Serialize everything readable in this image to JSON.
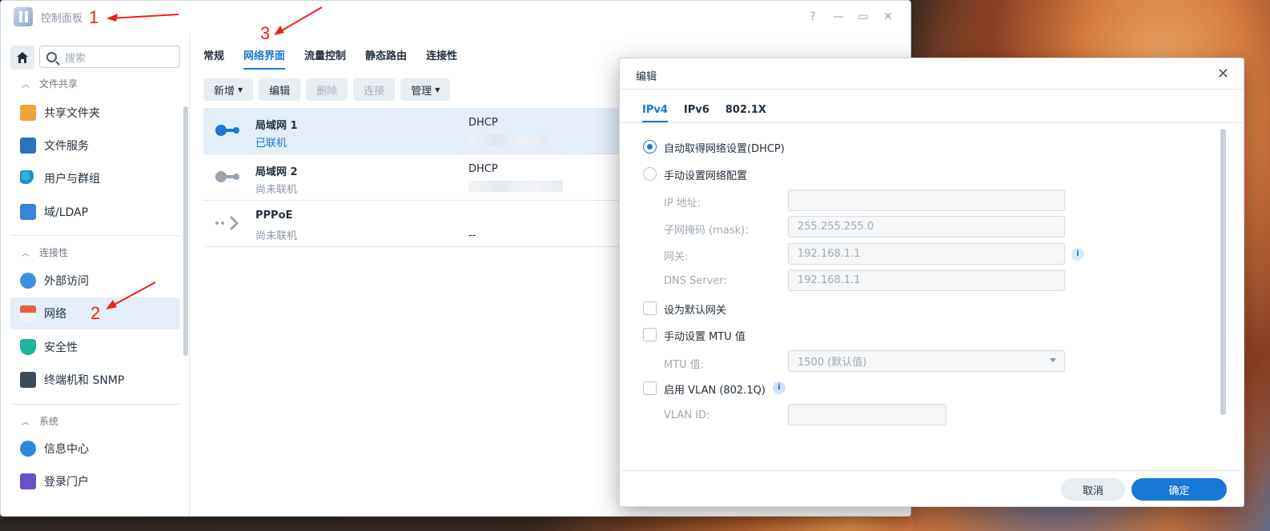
{
  "window": {
    "title": "控制面板",
    "controls": [
      "?",
      "—",
      "▭",
      "✕"
    ]
  },
  "sidebar": {
    "search_placeholder": "搜索",
    "sections": [
      {
        "label": "文件共享",
        "items": [
          {
            "label": "共享文件夹",
            "icon": "folder-icon"
          },
          {
            "label": "文件服务",
            "icon": "file-services-icon"
          },
          {
            "label": "用户与群组",
            "icon": "users-icon"
          },
          {
            "label": "域/LDAP",
            "icon": "ldap-icon"
          }
        ]
      },
      {
        "label": "连接性",
        "items": [
          {
            "label": "外部访问",
            "icon": "external-access-icon"
          },
          {
            "label": "网络",
            "icon": "network-icon"
          },
          {
            "label": "安全性",
            "icon": "shield-icon"
          },
          {
            "label": "终端机和 SNMP",
            "icon": "terminal-icon"
          }
        ]
      },
      {
        "label": "系统",
        "items": [
          {
            "label": "信息中心",
            "icon": "info-center-icon"
          },
          {
            "label": "登录门户",
            "icon": "login-portal-icon"
          }
        ]
      }
    ]
  },
  "main": {
    "tabs": [
      "常规",
      "网络界面",
      "流量控制",
      "静态路由",
      "连接性"
    ],
    "active_tab": "网络界面",
    "toolbar": {
      "add": "新增",
      "edit": "编辑",
      "delete": "删除",
      "connect": "连接",
      "manage": "管理"
    },
    "interfaces": [
      {
        "name": "局域网 1",
        "status": "已联机",
        "type": "DHCP",
        "ip": ""
      },
      {
        "name": "局域网 2",
        "status": "尚未联机",
        "type": "DHCP",
        "ip": ""
      },
      {
        "name": "PPPoE",
        "status": "尚未联机",
        "type": "",
        "ip": "--"
      }
    ]
  },
  "dialog": {
    "title": "编辑",
    "tabs": [
      "IPv4",
      "IPv6",
      "802.1X"
    ],
    "auto_dhcp": "自动取得网络设置(DHCP)",
    "manual": "手动设置网络配置",
    "ip_label": "IP 地址:",
    "ip_value": "",
    "mask_label": "子网掩码 (mask):",
    "mask_value": "255.255.255.0",
    "gateway_label": "网关:",
    "gateway_value": "192.168.1.1",
    "dns_label": "DNS Server:",
    "dns_value": "192.168.1.1",
    "default_gateway": "设为默认网关",
    "manual_mtu": "手动设置 MTU 值",
    "mtu_label": "MTU 值:",
    "mtu_value": "1500 (默认值)",
    "vlan": "启用 VLAN (802.1Q)",
    "vlan_id_label": "VLAN ID:",
    "vlan_id_value": "",
    "cancel": "取消",
    "ok": "确定"
  },
  "annotations": [
    "1",
    "2",
    "3"
  ],
  "colors": {
    "accent": "#1778d6",
    "annotation": "#e8241a"
  }
}
